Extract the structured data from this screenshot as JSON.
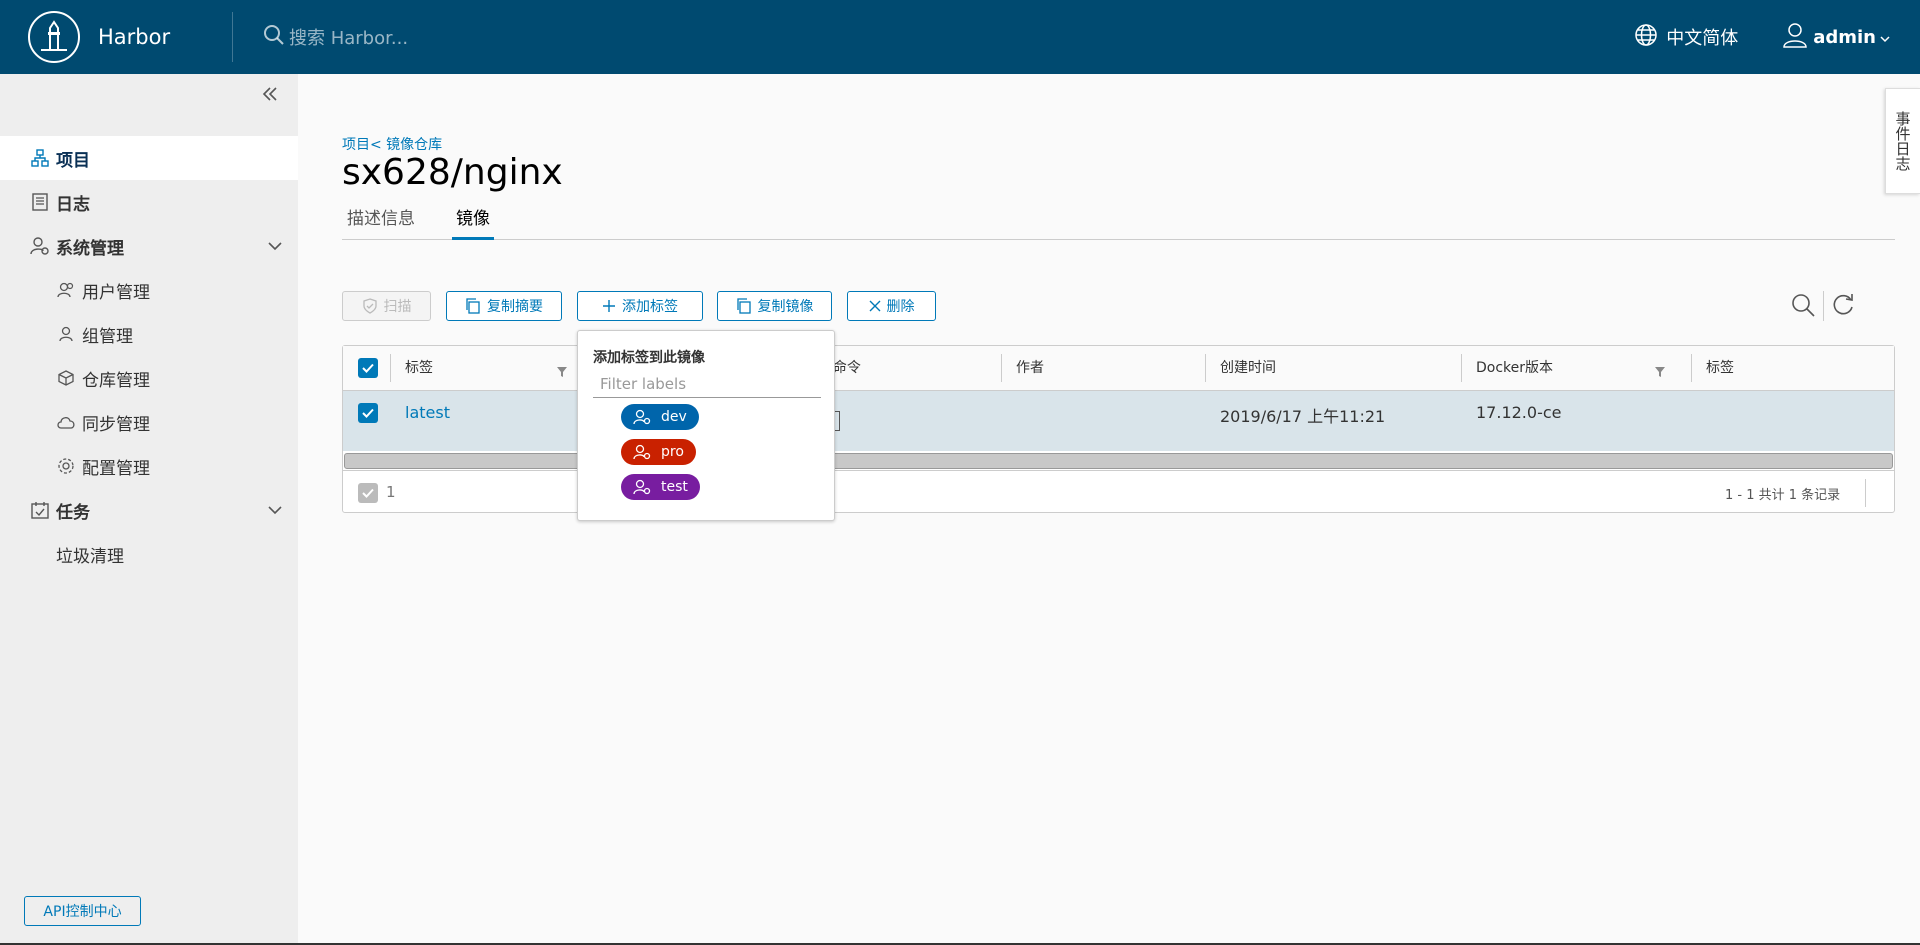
{
  "header": {
    "brand": "Harbor",
    "search_placeholder": "搜索 Harbor...",
    "language": "中文简体",
    "user": "admin"
  },
  "sidebar": {
    "items": [
      {
        "label": "项目",
        "icon": "project-icon"
      },
      {
        "label": "日志",
        "icon": "log-icon"
      },
      {
        "label": "系统管理",
        "icon": "admin-icon"
      },
      {
        "label": "用户管理",
        "icon": "users-icon"
      },
      {
        "label": "组管理",
        "icon": "group-icon"
      },
      {
        "label": "仓库管理",
        "icon": "box-icon"
      },
      {
        "label": "同步管理",
        "icon": "cloud-sync-icon"
      },
      {
        "label": "配置管理",
        "icon": "gear-icon"
      },
      {
        "label": "任务",
        "icon": "task-icon"
      },
      {
        "label": "垃圾清理",
        "icon": ""
      }
    ],
    "api_button": "API控制中心"
  },
  "breadcrumb": "项目< 镜像仓库",
  "page_title": "sx628/nginx",
  "tabs": [
    "描述信息",
    "镜像"
  ],
  "toolbar": {
    "scan": "扫描",
    "copy_digest": "复制摘要",
    "add_label": "添加标签",
    "copy_image": "复制镜像",
    "delete": "删除"
  },
  "table": {
    "columns": [
      "标签",
      "拉取命令",
      "作者",
      "创建时间",
      "Docker版本",
      "标签"
    ],
    "visible_cmd_header": "l命令",
    "rows": [
      {
        "tag": "latest",
        "author": "",
        "created": "2019/6/17 上午11:21",
        "docker_version": "17.12.0-ce",
        "labels": ""
      }
    ],
    "selected_count": "1",
    "pagination": "1 - 1 共计 1 条记录"
  },
  "dropdown": {
    "title": "添加标签到此镜像",
    "filter_placeholder": "Filter labels",
    "labels": [
      {
        "name": "dev",
        "color": "#0065ab"
      },
      {
        "name": "pro",
        "color": "#c92100"
      },
      {
        "name": "test",
        "color": "#781da0"
      }
    ]
  },
  "event_tab": "事件日志",
  "colors": {
    "header": "#004a70",
    "accent": "#0079b8"
  }
}
